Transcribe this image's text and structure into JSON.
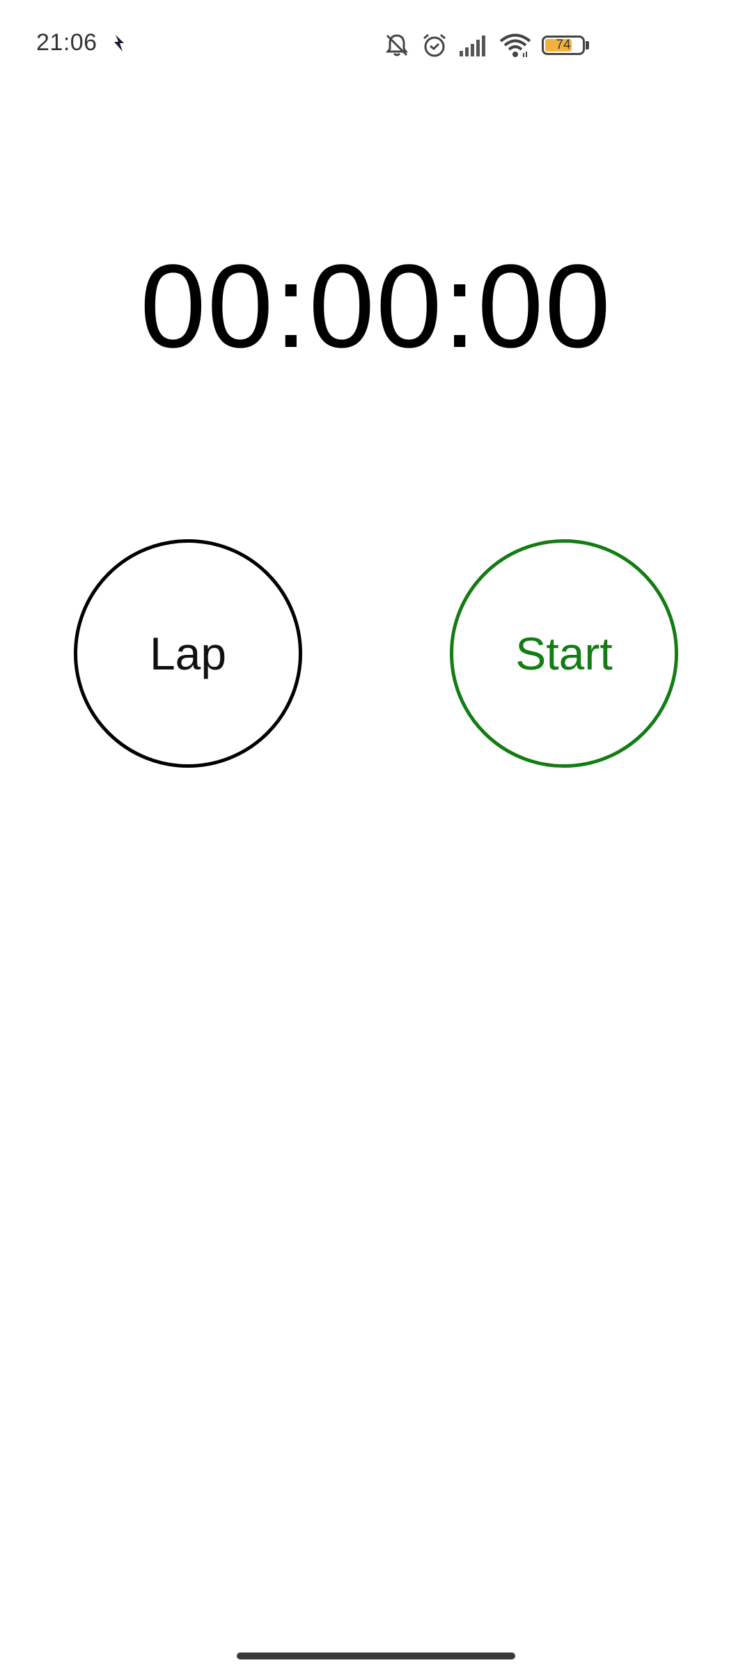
{
  "status_bar": {
    "time": "21:06",
    "notification_icon": "app-notification-icon",
    "icons": [
      "bell-muted-icon",
      "alarm-clock-icon",
      "signal-icon",
      "wifi-icon",
      "battery-icon"
    ],
    "battery_percent": "74",
    "battery_level": 0.74,
    "battery_color": "#f2b33d"
  },
  "stopwatch": {
    "display": "00:00:00"
  },
  "controls": {
    "lap_label": "Lap",
    "start_label": "Start",
    "lap_color": "#000000",
    "start_color": "#137c13"
  }
}
